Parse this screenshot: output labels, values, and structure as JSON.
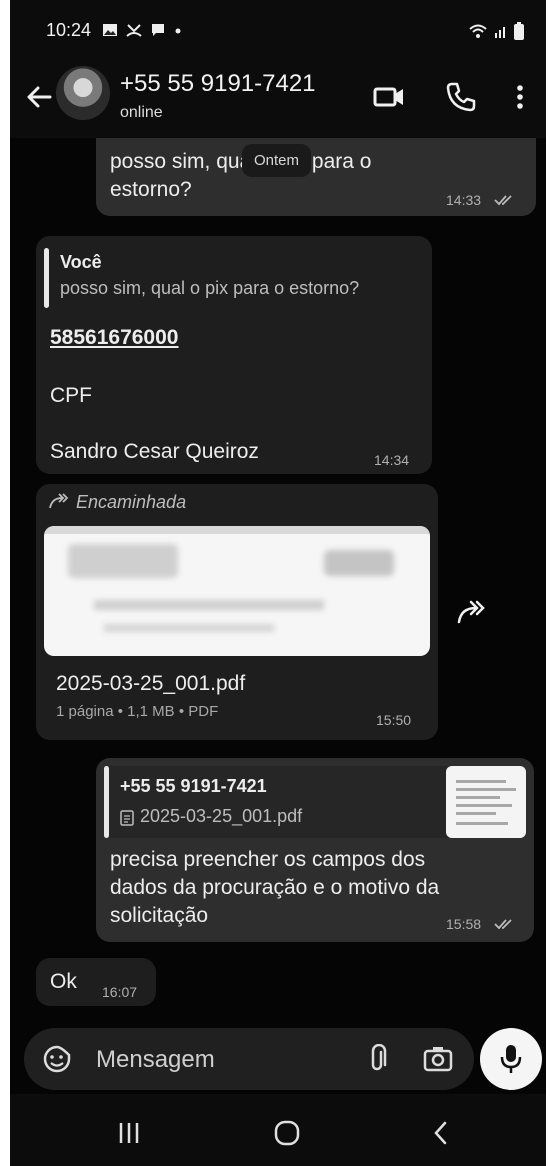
{
  "status_bar": {
    "time": "10:24"
  },
  "header": {
    "contact_name": "+55 55 9191-7421",
    "contact_status": "online"
  },
  "chat": {
    "day_chip": "Ontem",
    "messages": [
      {
        "direction": "out",
        "text_line1": "posso sim, qual o pix para o",
        "text_line2": "estorno?",
        "time": "14:33"
      },
      {
        "direction": "in",
        "quote_author": "Você",
        "quote_text": "posso sim, qual o pix para o estorno?",
        "pix_key": "58561676000",
        "line_cpf": "CPF",
        "line_name": "Sandro Cesar Queiroz",
        "time": "14:34"
      },
      {
        "direction": "in",
        "forwarded_label": "Encaminhada",
        "file_name": "2025-03-25_001.pdf",
        "file_meta": "1 página • 1,1 MB • PDF",
        "time": "15:50"
      },
      {
        "direction": "out",
        "quote_author": "+55 55 9191-7421",
        "quote_file": "2025-03-25_001.pdf",
        "text_line1": "precisa preencher os campos dos",
        "text_line2": "dados da procuração e o motivo da",
        "text_line3": "solicitação",
        "time": "15:58"
      },
      {
        "direction": "in",
        "text": "Ok",
        "time": "16:07"
      }
    ]
  },
  "composer": {
    "placeholder": "Mensagem"
  },
  "colors": {
    "background": "#050505",
    "bubble_in": "#1e1e1e",
    "bubble_out": "#2e2e2e",
    "mic_button": "#f5f5f5"
  }
}
